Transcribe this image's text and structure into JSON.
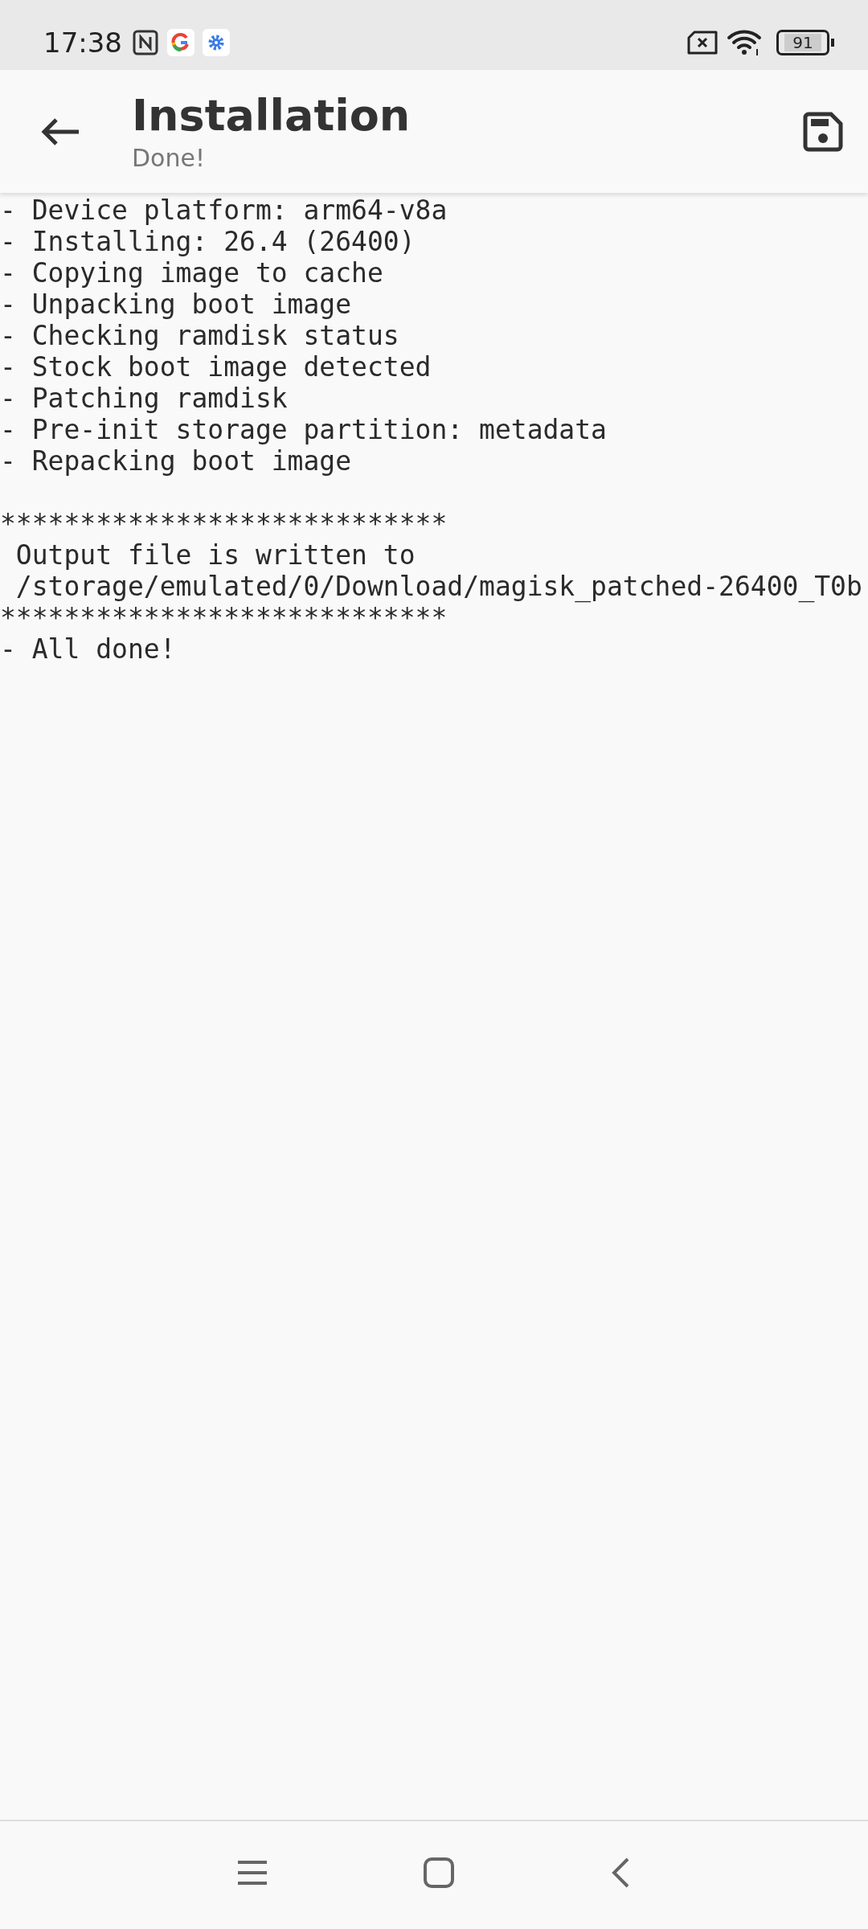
{
  "status_bar": {
    "time": "17:38",
    "battery": "91"
  },
  "app_bar": {
    "title": "Installation",
    "subtitle": "Done!"
  },
  "log_blocks": [
    {
      "lines": [
        "- Device platform: arm64-v8a",
        "- Installing: 26.4 (26400)",
        "- Copying image to cache",
        "- Unpacking boot image",
        "- Checking ramdisk status",
        "- Stock boot image detected",
        "- Patching ramdisk",
        "- Pre-init storage partition: metadata",
        "- Repacking boot image"
      ]
    },
    {
      "lines": [
        "****************************",
        " Output file is written to",
        " /storage/emulated/0/Download/magisk_patched-26400_T0b",
        "****************************",
        "- All done!"
      ]
    }
  ]
}
